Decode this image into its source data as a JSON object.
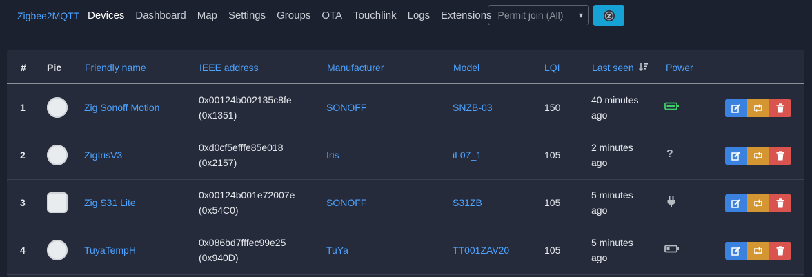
{
  "nav": {
    "brand": "Zigbee2MQTT",
    "links": [
      "Devices",
      "Dashboard",
      "Map",
      "Settings",
      "Groups",
      "OTA",
      "Touchlink",
      "Logs",
      "Extensions"
    ],
    "permit_join_label": "Permit join (All)"
  },
  "table": {
    "headers": {
      "num": "#",
      "pic": "Pic",
      "friendly_name": "Friendly name",
      "ieee": "IEEE address",
      "manufacturer": "Manufacturer",
      "model": "Model",
      "lqi": "LQI",
      "last_seen": "Last seen",
      "power": "Power"
    },
    "rows": [
      {
        "num": "1",
        "name": "Zig Sonoff Motion",
        "ieee": "0x00124b002135c8fe",
        "nwk": "(0x1351)",
        "manufacturer": "SONOFF",
        "model": "SNZB-03",
        "lqi": "150",
        "last_seen_1": "40 minutes",
        "last_seen_2": "ago",
        "power": "battery-high-icon"
      },
      {
        "num": "2",
        "name": "ZigIrisV3",
        "ieee": "0xd0cf5efffe85e018",
        "nwk": "(0x2157)",
        "manufacturer": "Iris",
        "model": "iL07_1",
        "lqi": "105",
        "last_seen_1": "2 minutes",
        "last_seen_2": "ago",
        "power": "question-icon"
      },
      {
        "num": "3",
        "name": "Zig S31 Lite",
        "ieee": "0x00124b001e72007e",
        "nwk": "(0x54C0)",
        "manufacturer": "SONOFF",
        "model": "S31ZB",
        "lqi": "105",
        "last_seen_1": "5 minutes",
        "last_seen_2": "ago",
        "power": "plug-icon"
      },
      {
        "num": "4",
        "name": "TuyaTempH",
        "ieee": "0x086bd7fffec99e25",
        "nwk": "(0x940D)",
        "manufacturer": "TuYa",
        "model": "TT001ZAV20",
        "lqi": "105",
        "last_seen_1": "5 minutes",
        "last_seen_2": "ago",
        "power": "battery-low-icon"
      }
    ]
  }
}
